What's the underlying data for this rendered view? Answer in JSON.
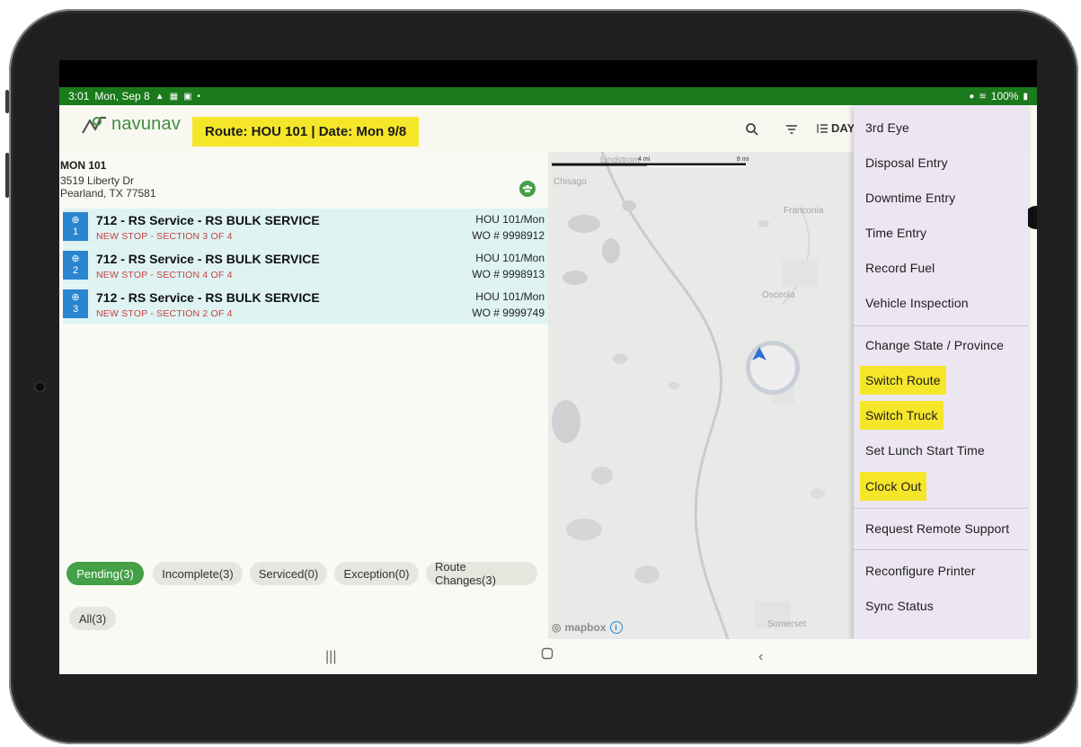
{
  "statusbar": {
    "time": "3:01",
    "date": "Mon, Sep 8",
    "battery": "100%"
  },
  "header": {
    "logo_text": "navunav",
    "route_banner": "Route: HOU 101 | Date: Mon 9/8",
    "view_label": "DAY"
  },
  "location": {
    "title": "MON 101",
    "address1": "3519 Liberty Dr",
    "address2": "Pearland, TX 77581"
  },
  "stops": [
    {
      "number": "1",
      "title": "712 - RS Service - RS BULK SERVICE",
      "subtitle": "NEW STOP - SECTION 3 OF 4",
      "route": "HOU 101/Mon",
      "wo": "WO # 9998912"
    },
    {
      "number": "2",
      "title": "712 - RS Service - RS BULK SERVICE",
      "subtitle": "NEW STOP - SECTION 4 OF 4",
      "route": "HOU 101/Mon",
      "wo": "WO # 9998913"
    },
    {
      "number": "3",
      "title": "712 - RS Service - RS BULK SERVICE",
      "subtitle": "NEW STOP - SECTION 2 OF 4",
      "route": "HOU 101/Mon",
      "wo": "WO # 9999749"
    }
  ],
  "filters": {
    "pending": "Pending(3)",
    "incomplete": "Incomplete(3)",
    "serviced": "Serviced(0)",
    "exception": "Exception(0)",
    "route_changes": "Route Changes(3)",
    "all": "All(3)"
  },
  "map": {
    "labels": {
      "lindstrom": "Lindstrom",
      "chisago": "Chisago",
      "franconia": "Franconia",
      "osceola": "Osceola",
      "somerset": "Somerset"
    },
    "scale_left": "4 mi",
    "scale_right": "8 mi",
    "attribution": "mapbox"
  },
  "menu": {
    "items": [
      "3rd Eye",
      "Disposal Entry",
      "Downtime Entry",
      "Time Entry",
      "Record Fuel",
      "Vehicle Inspection",
      "Change State / Province",
      "Switch Route",
      "Switch Truck",
      "Set Lunch Start Time",
      "Clock Out",
      "Request Remote Support",
      "Reconfigure Printer",
      "Sync Status"
    ]
  },
  "colors": {
    "status_green": "#1b7a1b",
    "highlight_yellow": "#f5e62a",
    "accent_green": "#43a047",
    "stop_blue": "#2a85d0"
  }
}
